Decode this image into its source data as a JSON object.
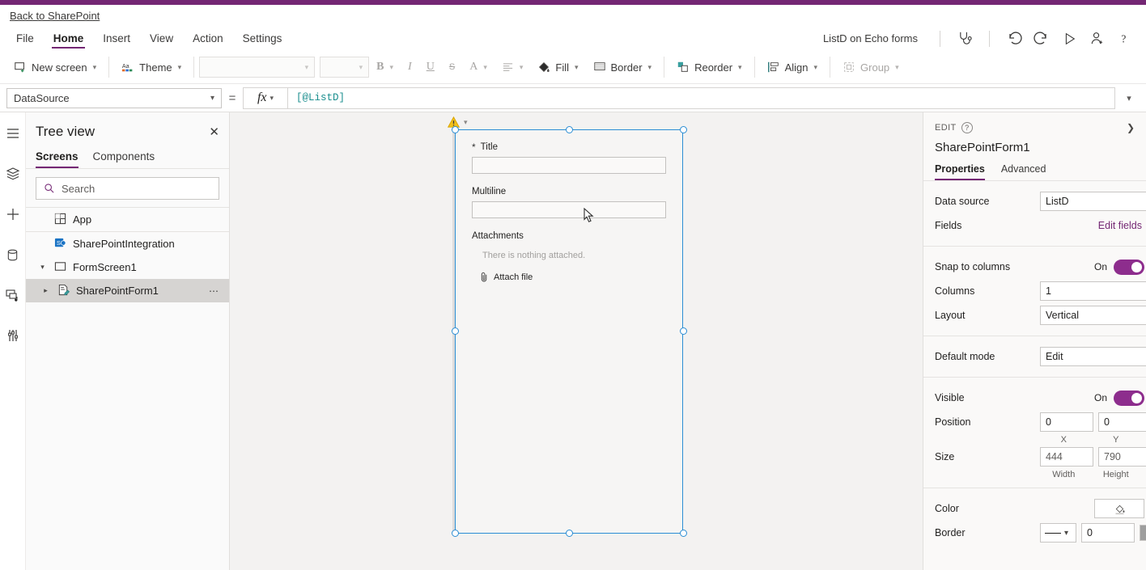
{
  "brand": {
    "purple": "#742774",
    "accent_link": "#742774",
    "formula_text": "#1a8e8e",
    "select_blue": "#2a8dd4",
    "toggle_on": "#8d2d8d"
  },
  "topbar": {
    "back_link": "Back to SharePoint"
  },
  "menubar": {
    "items": [
      "File",
      "Home",
      "Insert",
      "View",
      "Action",
      "Settings"
    ],
    "active": "Home",
    "app_name": "ListD on Echo forms",
    "right_icons": [
      "stethoscope-icon",
      "undo-icon",
      "redo-icon",
      "play-icon",
      "share-user-icon",
      "help-icon"
    ]
  },
  "ribbon": {
    "new_screen": "New screen",
    "theme": "Theme",
    "font_family_value": "",
    "font_size_value": "",
    "bold": "B",
    "italic": "I",
    "underline": "U",
    "strikethrough": "S",
    "font_color": "A",
    "align": "align-icon",
    "fill": "Fill",
    "border": "Border",
    "reorder": "Reorder",
    "align_label": "Align",
    "group": "Group"
  },
  "formulabar": {
    "property": "DataSource",
    "equals": "=",
    "fx": "fx",
    "formula": "[@ListD]"
  },
  "rail": {
    "icons": [
      "hamburger-menu-icon",
      "tree-view-layers-icon",
      "insert-plus-icon",
      "data-cylinder-icon",
      "media-icon",
      "advanced-tools-icon"
    ]
  },
  "treeview": {
    "title": "Tree view",
    "tabs": [
      "Screens",
      "Components"
    ],
    "active_tab": "Screens",
    "search_placeholder": "Search",
    "nodes": [
      {
        "label": "App",
        "icon": "app-icon",
        "indent": 0,
        "chevron": "",
        "selected": false,
        "dots": false
      },
      {
        "label": "SharePointIntegration",
        "icon": "sharepoint-icon",
        "indent": 0,
        "chevron": "",
        "selected": false,
        "dots": false
      },
      {
        "label": "FormScreen1",
        "icon": "screen-icon",
        "indent": 0,
        "chevron": "v",
        "selected": false,
        "dots": false
      },
      {
        "label": "SharePointForm1",
        "icon": "form-icon",
        "indent": 1,
        "chevron": ">",
        "selected": true,
        "dots": true
      }
    ]
  },
  "canvas": {
    "warning": "warning-triangle-icon",
    "form": {
      "fields": [
        {
          "label": "Title",
          "required": true,
          "value": ""
        },
        {
          "label": "Multiline",
          "required": false,
          "value": ""
        }
      ],
      "attachments_label": "Attachments",
      "attachments_empty": "There is nothing attached.",
      "attach_file": "Attach file"
    }
  },
  "properties": {
    "edit_label": "EDIT",
    "control_name": "SharePointForm1",
    "tabs": [
      "Properties",
      "Advanced"
    ],
    "active_tab": "Properties",
    "rows": {
      "data_source_label": "Data source",
      "data_source_value": "ListD",
      "fields_label": "Fields",
      "edit_fields_link": "Edit fields",
      "snap_label": "Snap to columns",
      "snap_state": "On",
      "columns_label": "Columns",
      "columns_value": "1",
      "layout_label": "Layout",
      "layout_value": "Vertical",
      "default_mode_label": "Default mode",
      "default_mode_value": "Edit",
      "visible_label": "Visible",
      "visible_state": "On",
      "position_label": "Position",
      "position_x": "0",
      "position_y": "0",
      "position_x_caption": "X",
      "position_y_caption": "Y",
      "size_label": "Size",
      "size_width": "444",
      "size_height": "790",
      "size_width_caption": "Width",
      "size_height_caption": "Height",
      "color_label": "Color",
      "border_label": "Border",
      "border_width": "0"
    }
  }
}
